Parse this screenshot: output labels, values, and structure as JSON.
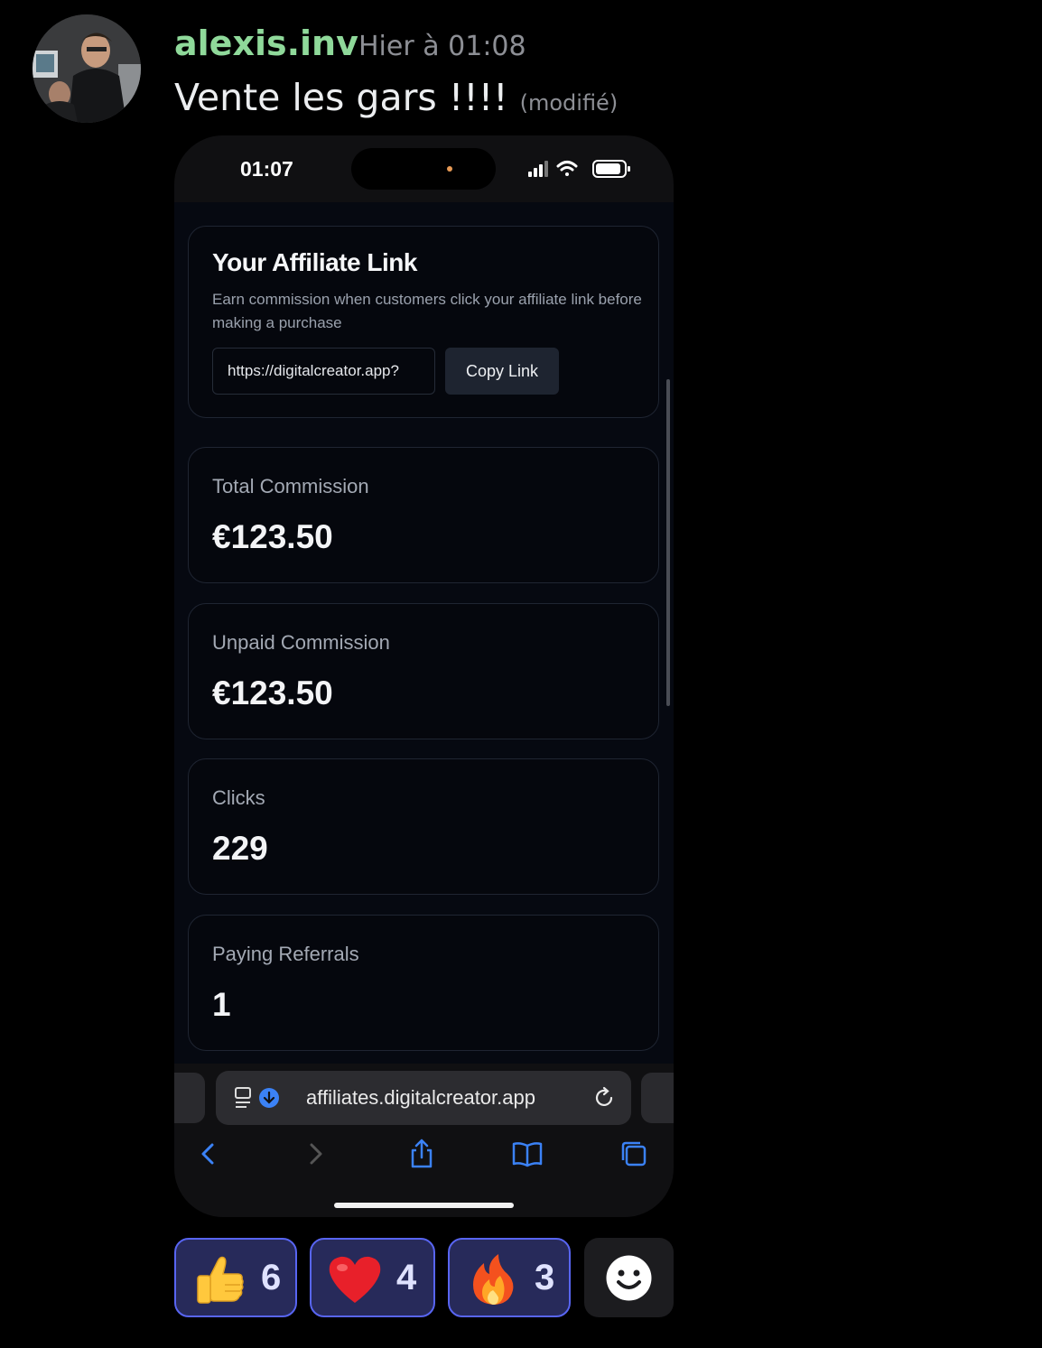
{
  "message": {
    "username": "alexis.inv",
    "timestamp": "Hier à 01:08",
    "text": "Vente les gars !!!!",
    "edited_label": "(modifié)",
    "username_color": "#8fd99a"
  },
  "screenshot": {
    "status_time": "01:07",
    "affiliate_card": {
      "title": "Your Affiliate Link",
      "description": "Earn commission when customers click your affiliate link before making a purchase",
      "link_value": "https://digitalcreator.app?",
      "copy_button": "Copy Link"
    },
    "stats": [
      {
        "label": "Total Commission",
        "value": "€123.50"
      },
      {
        "label": "Unpaid Commission",
        "value": "€123.50"
      },
      {
        "label": "Clicks",
        "value": "229"
      },
      {
        "label": "Paying Referrals",
        "value": "1"
      }
    ],
    "browser": {
      "url": "affiliates.digitalcreator.app",
      "icons": [
        "page-menu-icon",
        "download-icon",
        "reload-icon",
        "back-icon",
        "forward-icon",
        "share-icon",
        "bookmarks-icon",
        "tabs-icon"
      ]
    }
  },
  "reactions": [
    {
      "emoji": "thumbs-up",
      "count": "6"
    },
    {
      "emoji": "red-heart",
      "count": "4"
    },
    {
      "emoji": "fire",
      "count": "3"
    }
  ],
  "colors": {
    "background": "#000000",
    "reaction_active_bg": "#272a5a",
    "reaction_active_border": "#5865f2",
    "card_bg": "#05070d",
    "card_border": "#1f2532"
  }
}
